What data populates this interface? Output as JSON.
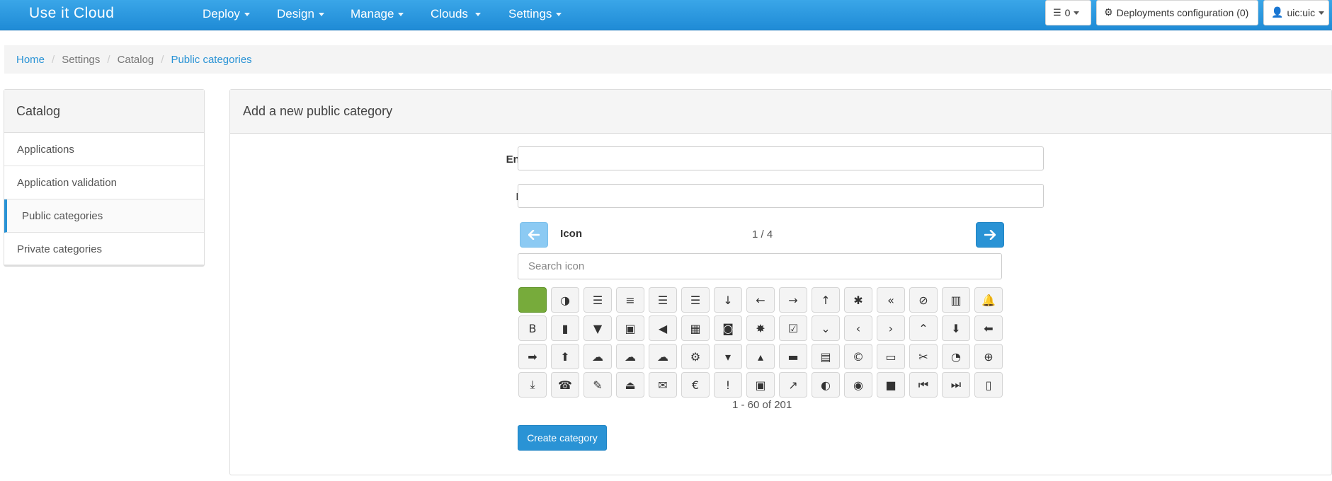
{
  "navbar": {
    "brand": "Use it Cloud",
    "menus": [
      {
        "label": "Deploy"
      },
      {
        "label": "Design"
      },
      {
        "label": "Manage"
      },
      {
        "label": "Clouds"
      },
      {
        "label": "Settings"
      }
    ],
    "queue_count": "0",
    "deployments_config_label": "Deployments configuration (0)",
    "user_label": "uic:uic"
  },
  "breadcrumb": {
    "home": "Home",
    "settings": "Settings",
    "catalog": "Catalog",
    "current": "Public categories"
  },
  "sidebar": {
    "title": "Catalog",
    "items": [
      {
        "label": "Applications"
      },
      {
        "label": "Application validation"
      },
      {
        "label": "Public categories"
      },
      {
        "label": "Private categories"
      }
    ]
  },
  "form": {
    "title": "Add a new public category",
    "english_name_label": "English name",
    "required_mark": "*",
    "english_name_value": "",
    "french_name_label": "French name",
    "french_name_value": "",
    "icon_label": "Icon",
    "page_indicator": "1 / 4",
    "search_placeholder": "Search icon",
    "icons": [
      {
        "name": "square-green-icon",
        "glyph": ""
      },
      {
        "name": "adjust-icon",
        "glyph": "◑"
      },
      {
        "name": "align-center-icon",
        "glyph": "☰"
      },
      {
        "name": "align-justify-icon",
        "glyph": "≡"
      },
      {
        "name": "align-left-icon",
        "glyph": "☰"
      },
      {
        "name": "align-right-icon",
        "glyph": "☰"
      },
      {
        "name": "arrow-down-icon",
        "glyph": "↓"
      },
      {
        "name": "arrow-left-icon",
        "glyph": "←"
      },
      {
        "name": "arrow-right-icon",
        "glyph": "→"
      },
      {
        "name": "arrow-up-icon",
        "glyph": "↑"
      },
      {
        "name": "asterisk-icon",
        "glyph": "✱"
      },
      {
        "name": "backward-icon",
        "glyph": "«"
      },
      {
        "name": "ban-icon",
        "glyph": "⊘"
      },
      {
        "name": "barcode-icon",
        "glyph": "▥"
      },
      {
        "name": "bell-icon",
        "glyph": "🔔"
      },
      {
        "name": "bold-icon",
        "glyph": "B"
      },
      {
        "name": "book-icon",
        "glyph": "▮"
      },
      {
        "name": "bookmark-icon",
        "glyph": "▼"
      },
      {
        "name": "briefcase-icon",
        "glyph": "▣"
      },
      {
        "name": "bullhorn-icon",
        "glyph": "◀"
      },
      {
        "name": "calendar-icon",
        "glyph": "▦"
      },
      {
        "name": "camera-icon",
        "glyph": "◙"
      },
      {
        "name": "certificate-icon",
        "glyph": "✸"
      },
      {
        "name": "check-icon",
        "glyph": "☑"
      },
      {
        "name": "chevron-down-icon",
        "glyph": "⌄"
      },
      {
        "name": "chevron-left-icon",
        "glyph": "‹"
      },
      {
        "name": "chevron-right-icon",
        "glyph": "›"
      },
      {
        "name": "chevron-up-icon",
        "glyph": "⌃"
      },
      {
        "name": "circle-arrow-down-icon",
        "glyph": "⬇"
      },
      {
        "name": "circle-arrow-left-icon",
        "glyph": "⬅"
      },
      {
        "name": "circle-arrow-right-icon",
        "glyph": "➡"
      },
      {
        "name": "circle-arrow-up-icon",
        "glyph": "⬆"
      },
      {
        "name": "cloud-icon",
        "glyph": "☁"
      },
      {
        "name": "cloud-download-icon",
        "glyph": "☁"
      },
      {
        "name": "cloud-upload-icon",
        "glyph": "☁"
      },
      {
        "name": "cog-icon",
        "glyph": "⚙"
      },
      {
        "name": "collapse-down-icon",
        "glyph": "▾"
      },
      {
        "name": "collapse-up-icon",
        "glyph": "▴"
      },
      {
        "name": "comment-icon",
        "glyph": "▬"
      },
      {
        "name": "compressed-icon",
        "glyph": "▤"
      },
      {
        "name": "copyright-mark-icon",
        "glyph": "©"
      },
      {
        "name": "credit-card-icon",
        "glyph": "▭"
      },
      {
        "name": "cutlery-icon",
        "glyph": "✂"
      },
      {
        "name": "dashboard-icon",
        "glyph": "◔"
      },
      {
        "name": "download-icon",
        "glyph": "⊕"
      },
      {
        "name": "download-alt-icon",
        "glyph": "⤓"
      },
      {
        "name": "earphone-icon",
        "glyph": "☎"
      },
      {
        "name": "edit-icon",
        "glyph": "✎"
      },
      {
        "name": "eject-icon",
        "glyph": "⏏"
      },
      {
        "name": "envelope-icon",
        "glyph": "✉"
      },
      {
        "name": "euro-icon",
        "glyph": "€"
      },
      {
        "name": "exclamation-sign-icon",
        "glyph": "!"
      },
      {
        "name": "expand-icon",
        "glyph": "▣"
      },
      {
        "name": "export-icon",
        "glyph": "↗"
      },
      {
        "name": "eye-close-icon",
        "glyph": "◐"
      },
      {
        "name": "eye-open-icon",
        "glyph": "◉"
      },
      {
        "name": "facetime-video-icon",
        "glyph": "■"
      },
      {
        "name": "fast-backward-icon",
        "glyph": "⏮"
      },
      {
        "name": "fast-forward-icon",
        "glyph": "⏭"
      },
      {
        "name": "file-icon",
        "glyph": "▯"
      }
    ],
    "count_text": "1 - 60 of 201",
    "create_button": "Create category"
  }
}
